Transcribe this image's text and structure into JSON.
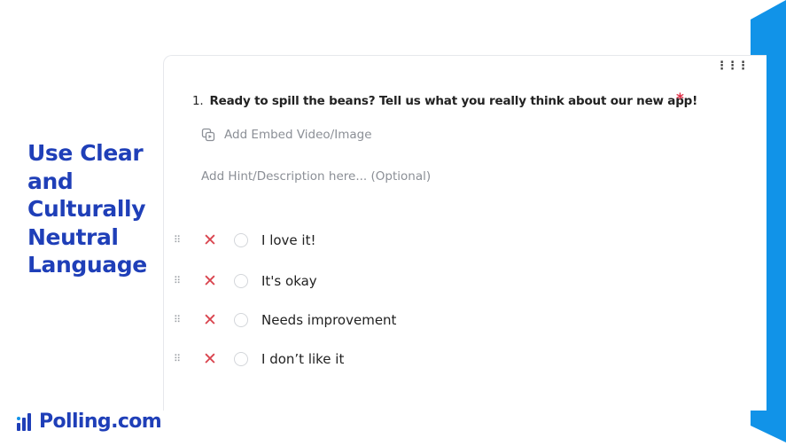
{
  "headline": [
    "Use Clear",
    "and",
    "Culturally",
    "Neutral",
    "Language"
  ],
  "brand": {
    "name": "Polling.com"
  },
  "question": {
    "number": "1.",
    "text": "Ready to spill the beans? Tell us what you really think about our new app!",
    "required_mark": "*",
    "embed_label": "Add Embed Video/Image",
    "hint_placeholder": "Add Hint/Description here... (Optional)"
  },
  "menu_icon": "more-dots-icon",
  "options": [
    {
      "label": "I love it!"
    },
    {
      "label": "It's okay"
    },
    {
      "label": "Needs improvement"
    },
    {
      "label": "I don’t like it"
    }
  ],
  "colors": {
    "accent": "#1f3fb8",
    "band": "#1193e8",
    "required": "#e0324a",
    "remove": "#d9444e"
  }
}
